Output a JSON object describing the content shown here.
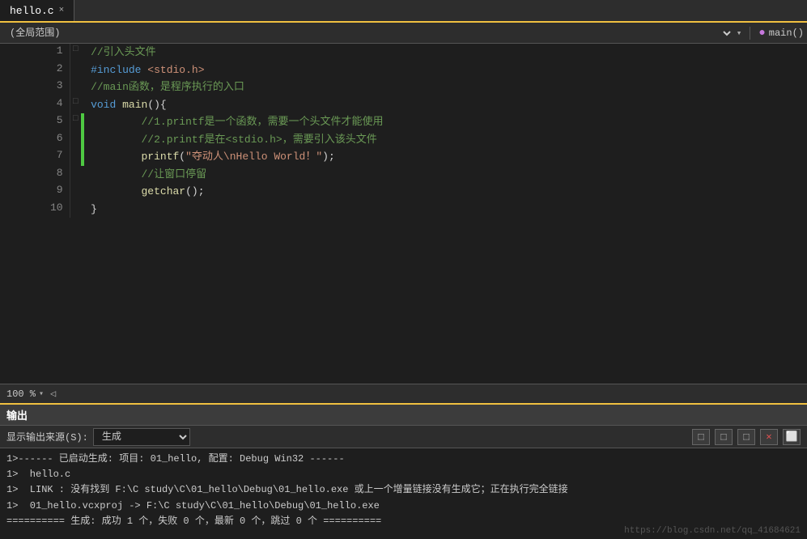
{
  "tab": {
    "filename": "hello.c",
    "close_label": "×"
  },
  "scope_bar": {
    "scope_text": "(全局范围)",
    "func_icon": "●",
    "func_text": "main()"
  },
  "editor": {
    "lines": [
      {
        "num": "1",
        "fold": "□",
        "bar": "",
        "content_parts": [
          {
            "text": "//引入头文件",
            "cls": "cm"
          }
        ]
      },
      {
        "num": "2",
        "fold": "",
        "bar": "",
        "content_parts": [
          {
            "text": "#include ",
            "cls": "pp"
          },
          {
            "text": "<stdio.h>",
            "cls": "inc"
          }
        ]
      },
      {
        "num": "3",
        "fold": "",
        "bar": "",
        "content_parts": [
          {
            "text": "//main函数，是程序执行的入口",
            "cls": "cm"
          }
        ]
      },
      {
        "num": "4",
        "fold": "□",
        "bar": "",
        "content_parts": [
          {
            "text": "void ",
            "cls": "kw"
          },
          {
            "text": "main",
            "cls": "fn"
          },
          {
            "text": "(){",
            "cls": "punc"
          }
        ]
      },
      {
        "num": "5",
        "fold": "□",
        "bar": "green",
        "content_parts": [
          {
            "text": "        //1.printf是一个函数，需要一个头文件才能使用",
            "cls": "cm"
          }
        ]
      },
      {
        "num": "6",
        "fold": "",
        "bar": "green",
        "content_parts": [
          {
            "text": "        //2.printf是在<stdio.h>，需要引入该头文件",
            "cls": "cm"
          }
        ]
      },
      {
        "num": "7",
        "fold": "",
        "bar": "green",
        "content_parts": [
          {
            "text": "        printf",
            "cls": "fn"
          },
          {
            "text": "(",
            "cls": "punc"
          },
          {
            "text": "\"夺动人\\nHello World！\"",
            "cls": "str"
          },
          {
            "text": ");",
            "cls": "punc"
          }
        ]
      },
      {
        "num": "8",
        "fold": "",
        "bar": "",
        "content_parts": [
          {
            "text": "        //让窗口停留",
            "cls": "cm"
          }
        ]
      },
      {
        "num": "9",
        "fold": "",
        "bar": "",
        "content_parts": [
          {
            "text": "        getchar",
            "cls": "fn"
          },
          {
            "text": "();",
            "cls": "punc"
          }
        ]
      },
      {
        "num": "10",
        "fold": "",
        "bar": "",
        "content_parts": [
          {
            "text": "}",
            "cls": "punc"
          }
        ]
      }
    ]
  },
  "status_bar": {
    "zoom": "100 %",
    "zoom_arrow": "▾",
    "scroll": "◁"
  },
  "output": {
    "header": "输出",
    "source_label": "显示输出来源(S):",
    "source_value": "生成",
    "toolbar_btns": [
      "⬤",
      "⬤",
      "⬤",
      "✕",
      "⬜"
    ],
    "lines": [
      "1>------ 已启动生成: 项目: 01_hello, 配置: Debug Win32 ------",
      "1>  hello.c",
      "1>  LINK : 没有找到 F:\\C study\\C\\01_hello\\Debug\\01_hello.exe 或上一个增量链接没有生成它；正在执行完全链接",
      "1>  01_hello.vcxproj -> F:\\C study\\C\\01_hello\\Debug\\01_hello.exe",
      "========== 生成: 成功 1 个，失败 0 个，最新 0 个，跳过 0 个 =========="
    ],
    "watermark": "https://blog.csdn.net/qq_41684621"
  }
}
